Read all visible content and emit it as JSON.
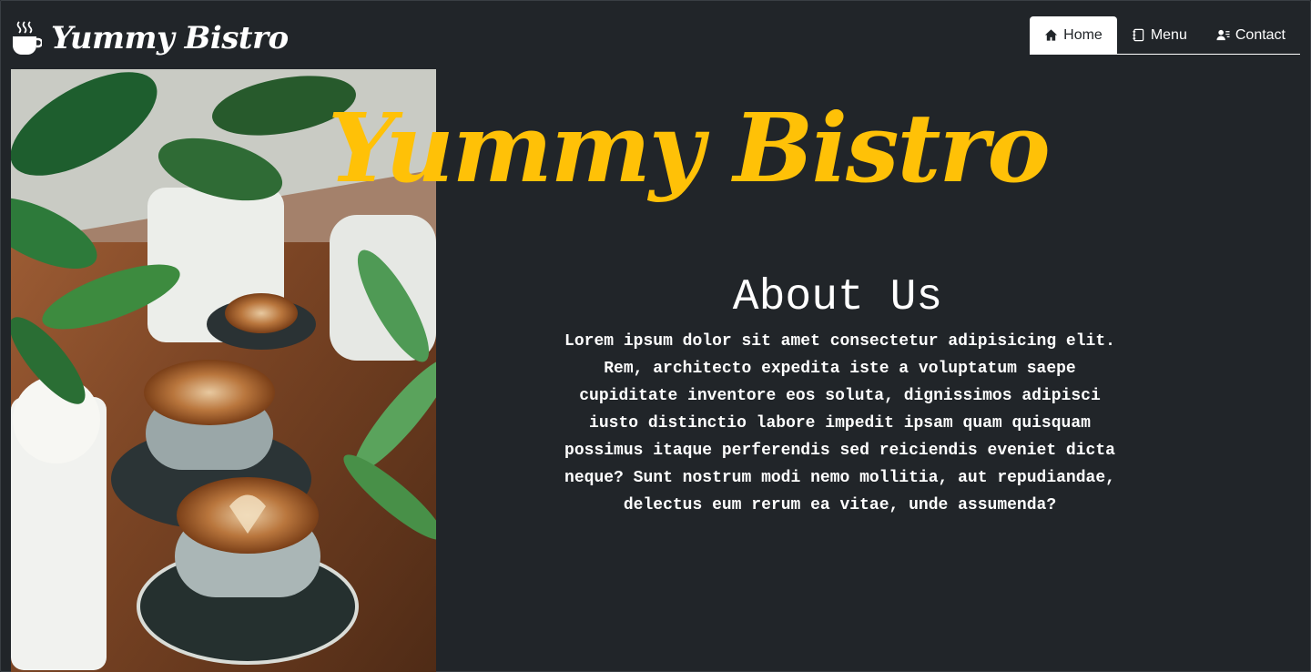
{
  "brand": {
    "name": "Yummy Bistro",
    "icon": "coffee-cup-icon"
  },
  "nav": {
    "items": [
      {
        "label": "Home",
        "icon": "home-icon",
        "active": true
      },
      {
        "label": "Menu",
        "icon": "journal-icon",
        "active": false
      },
      {
        "label": "Contact",
        "icon": "person-lines-icon",
        "active": false
      }
    ]
  },
  "hero": {
    "title": "Yummy Bistro",
    "image": "coffee-cups-with-plants-photo"
  },
  "about": {
    "heading": "About Us",
    "body": "Lorem ipsum dolor sit amet consectetur adipisicing elit. Rem, architecto expedita iste a voluptatum saepe cupiditate inventore eos soluta, dignissimos adipisci iusto distinctio labore impedit ipsam quam quisquam possimus itaque perferendis sed reiciendis eveniet dicta neque? Sunt nostrum modi nemo mollitia, aut repudiandae, delectus eum rerum ea vitae, unde assumenda?"
  },
  "colors": {
    "background": "#212529",
    "accent": "#ffc107",
    "text": "#ffffff"
  }
}
